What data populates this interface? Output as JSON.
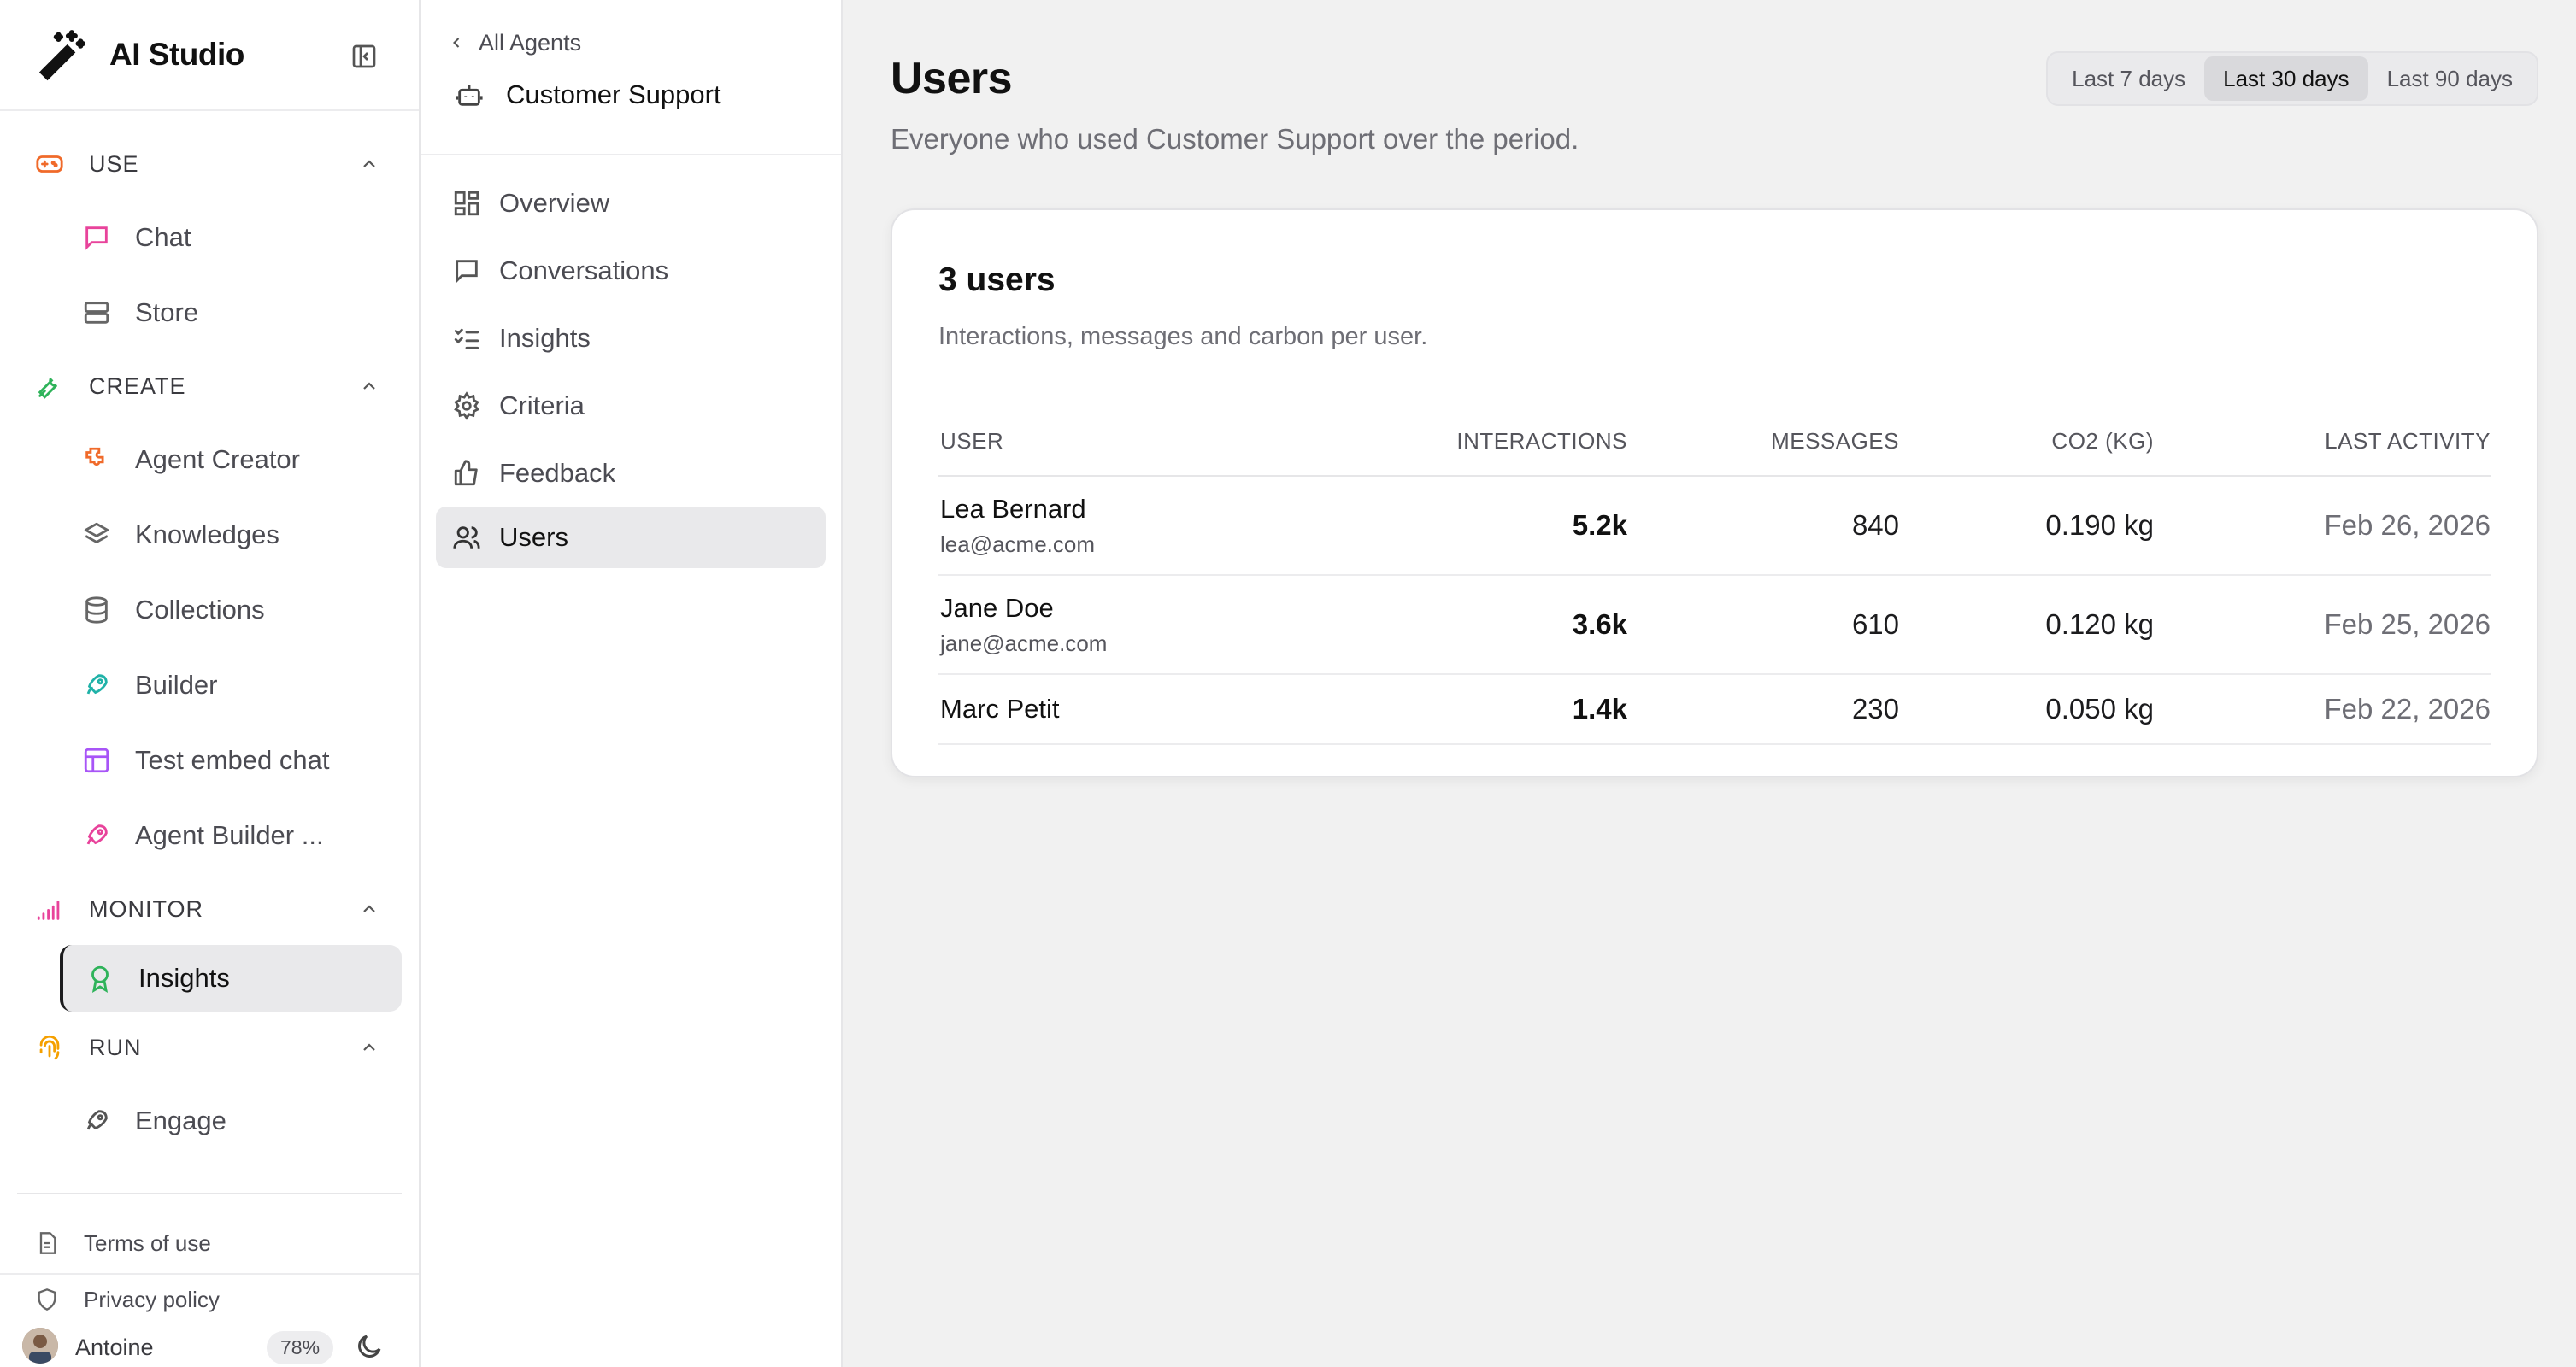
{
  "app": {
    "title": "AI Studio"
  },
  "sidebar": {
    "sections": [
      {
        "label": "USE",
        "items": [
          {
            "label": "Chat"
          },
          {
            "label": "Store"
          }
        ]
      },
      {
        "label": "CREATE",
        "items": [
          {
            "label": "Agent Creator"
          },
          {
            "label": "Knowledges"
          },
          {
            "label": "Collections"
          },
          {
            "label": "Builder"
          },
          {
            "label": "Test embed chat"
          },
          {
            "label": "Agent Builder ..."
          }
        ]
      },
      {
        "label": "MONITOR",
        "items": [
          {
            "label": "Insights"
          }
        ]
      },
      {
        "label": "RUN",
        "items": [
          {
            "label": "Engage"
          }
        ]
      }
    ],
    "legal": [
      {
        "label": "Terms of use"
      },
      {
        "label": "Privacy policy"
      }
    ],
    "user": {
      "name": "Antoine",
      "usage": "78%"
    }
  },
  "subnav": {
    "back": "All Agents",
    "agent": "Customer Support",
    "items": [
      {
        "label": "Overview"
      },
      {
        "label": "Conversations"
      },
      {
        "label": "Insights"
      },
      {
        "label": "Criteria"
      },
      {
        "label": "Feedback"
      },
      {
        "label": "Users"
      }
    ]
  },
  "main": {
    "title": "Users",
    "subtitle": "Everyone who used Customer Support over the period.",
    "ranges": [
      {
        "label": "Last 7 days"
      },
      {
        "label": "Last 30 days"
      },
      {
        "label": "Last 90 days"
      }
    ],
    "selected_range": "Last 30 days",
    "card": {
      "title": "3 users",
      "subtitle": "Interactions, messages and carbon per user.",
      "columns": {
        "user": "USER",
        "interactions": "INTERACTIONS",
        "messages": "MESSAGES",
        "co2": "CO2 (KG)",
        "last": "LAST ACTIVITY"
      },
      "rows": [
        {
          "name": "Lea Bernard",
          "email": "lea@acme.com",
          "interactions": "5.2k",
          "messages": "840",
          "co2": "0.190 kg",
          "last": "Feb 26, 2026"
        },
        {
          "name": "Jane Doe",
          "email": "jane@acme.com",
          "interactions": "3.6k",
          "messages": "610",
          "co2": "0.120 kg",
          "last": "Feb 25, 2026"
        },
        {
          "name": "Marc Petit",
          "email": "",
          "interactions": "1.4k",
          "messages": "230",
          "co2": "0.050 kg",
          "last": "Feb 22, 2026"
        }
      ]
    }
  },
  "colors": {
    "use": "#f06a2a",
    "chat": "#e8439b",
    "create": "#2fb35a",
    "agent_creator": "#f06a2a",
    "builder": "#20b2a8",
    "test_embed": "#a855f7",
    "agent_builder": "#e8439b",
    "monitor": "#e8439b",
    "insights": "#2fb35a",
    "run": "#f5a000"
  }
}
